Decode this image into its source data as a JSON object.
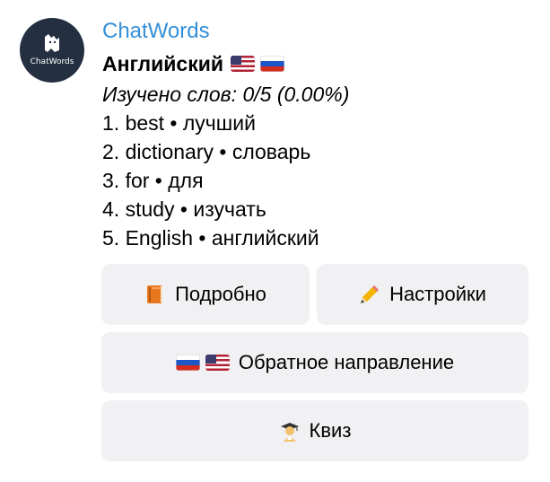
{
  "bot": {
    "name": "ChatWords",
    "avatar_caption": "ChatWords"
  },
  "message": {
    "title": "Английский",
    "learned": "Изучено слов: 0/5 (0.00%)",
    "words": [
      "1. best • лучший",
      "2. dictionary • словарь",
      "3. for • для",
      "4. study • изучать",
      "5. English • английский"
    ]
  },
  "buttons": {
    "details": "Подробно",
    "settings": "Настройки",
    "reverse": "Обратное направление",
    "quiz": "Квиз"
  },
  "colors": {
    "sender": "#3390d9",
    "button_bg": "#f1f1f3",
    "avatar_bg": "#243041"
  },
  "icons": {
    "flag_us": "flag-us-icon",
    "flag_ru": "flag-ru-icon",
    "details": "orange-book-icon",
    "settings": "pencil-icon",
    "quiz": "student-icon"
  }
}
